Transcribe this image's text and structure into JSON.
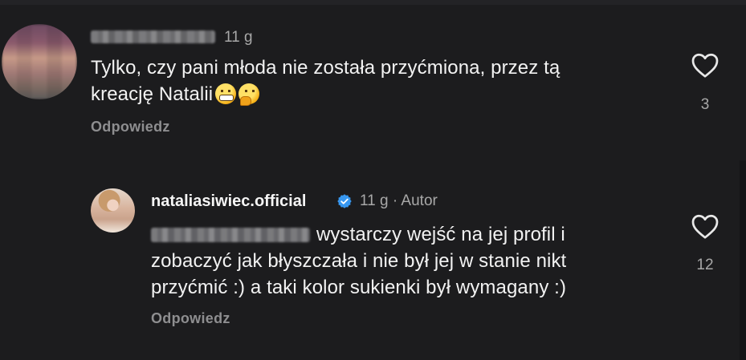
{
  "colors": {
    "background": "#1c1c1e",
    "text": "#f2f2f2",
    "meta": "#a8a8a8",
    "reply": "#8e8e90",
    "verified": "#3797f0"
  },
  "comments": [
    {
      "author_redacted": true,
      "time": "11 g",
      "text": "Tylko, czy pani młoda nie została przyćmiona, przez tą kreację Natalii",
      "text_line1": "Tylko, czy pani młoda nie została przyćmiona, przez tą",
      "text_line2": "kreację Natalii",
      "emojis": [
        "grimacing-face",
        "thinking-face"
      ],
      "reply_label": "Odpowiedz",
      "like_count": "3",
      "like_icon": "heart-outline-icon"
    },
    {
      "author": "nataliasiwiec.official",
      "verified": true,
      "time": "11 g",
      "separator": "·",
      "author_badge": "Autor",
      "mention_redacted": true,
      "text_line1": "wystarczy wejść na jej profil i",
      "text_line2": "zobaczyć jak błyszczała i nie był jej w stanie nikt",
      "text_line3": "przyćmić :) a taki kolor sukienki był wymagany :)",
      "reply_label": "Odpowiedz",
      "like_count": "12",
      "like_icon": "heart-outline-icon"
    }
  ]
}
